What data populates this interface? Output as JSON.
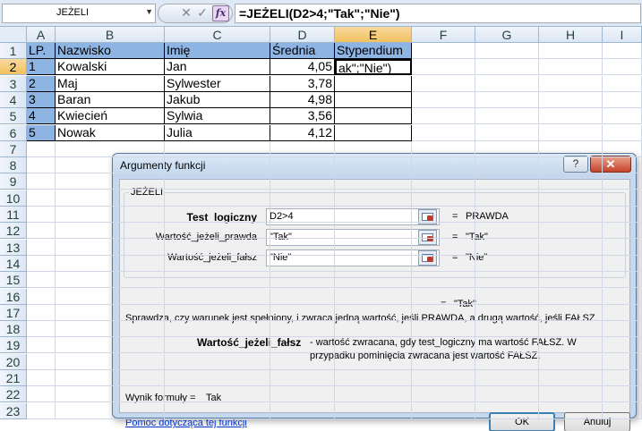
{
  "formula_bar": {
    "name_box": "JEŻELI",
    "name_box_arrow": "▼",
    "cancel_icon": "✕",
    "enter_icon": "✓",
    "fx_label": "fx",
    "formula": "=JEŻELI(D2>4;\"Tak\";\"Nie\")"
  },
  "columns": [
    "A",
    "B",
    "C",
    "D",
    "E",
    "F",
    "G",
    "H",
    "I"
  ],
  "rows": [
    "1",
    "2",
    "3",
    "4",
    "5",
    "6",
    "7",
    "8",
    "9",
    "10",
    "11",
    "12",
    "13",
    "14",
    "15",
    "16",
    "17",
    "18",
    "19",
    "20",
    "21",
    "22",
    "23"
  ],
  "table": {
    "headers": [
      "LP.",
      "Nazwisko",
      "Imię",
      "Średnia",
      "Stypendium"
    ],
    "rows": [
      [
        "1",
        "Kowalski",
        "Jan",
        "4,05",
        "ak\";\"Nie\")"
      ],
      [
        "2",
        "Maj",
        "Sylwester",
        "3,78",
        ""
      ],
      [
        "3",
        "Baran",
        "Jakub",
        "4,98",
        ""
      ],
      [
        "4",
        "Kwiecień",
        "Sylwia",
        "3,56",
        ""
      ],
      [
        "5",
        "Nowak",
        "Julia",
        "4,12",
        ""
      ]
    ]
  },
  "dialog": {
    "title": "Argumenty funkcji",
    "help_label": "?",
    "close_label": "✕",
    "function_name": "JEŻELI",
    "args": [
      {
        "label": "Test_logiczny",
        "value": "D2>4",
        "eq": "=",
        "result": "PRAWDA"
      },
      {
        "label": "Wartość_jeżeli_prawda",
        "value": "\"Tak\"",
        "eq": "=",
        "result": "\"Tak\""
      },
      {
        "label": "Wartość_jeżeli_fałsz",
        "value": "\"Nie\"",
        "eq": "=",
        "result": "\"Nie\""
      }
    ],
    "overall_eq": "=",
    "overall_result": "\"Tak\"",
    "description": "Sprawdza, czy warunek jest spełniony, i zwraca jedną wartość, jeśli PRAWDA, a drugą wartość, jeśli FAŁSZ.",
    "arg_desc_name": "Wartość_jeżeli_fałsz",
    "arg_desc_text": "- wartość zwracana, gdy test_logiczny ma wartość FAŁSZ. W przypadku pominięcia zwracana jest wartość FAŁSZ.",
    "result_label": "Wynik formuły =",
    "result_value": "Tak",
    "help_link": "Pomoc dotycząca tej funkcji",
    "ok_label": "OK",
    "cancel_label": "Anuluj"
  }
}
